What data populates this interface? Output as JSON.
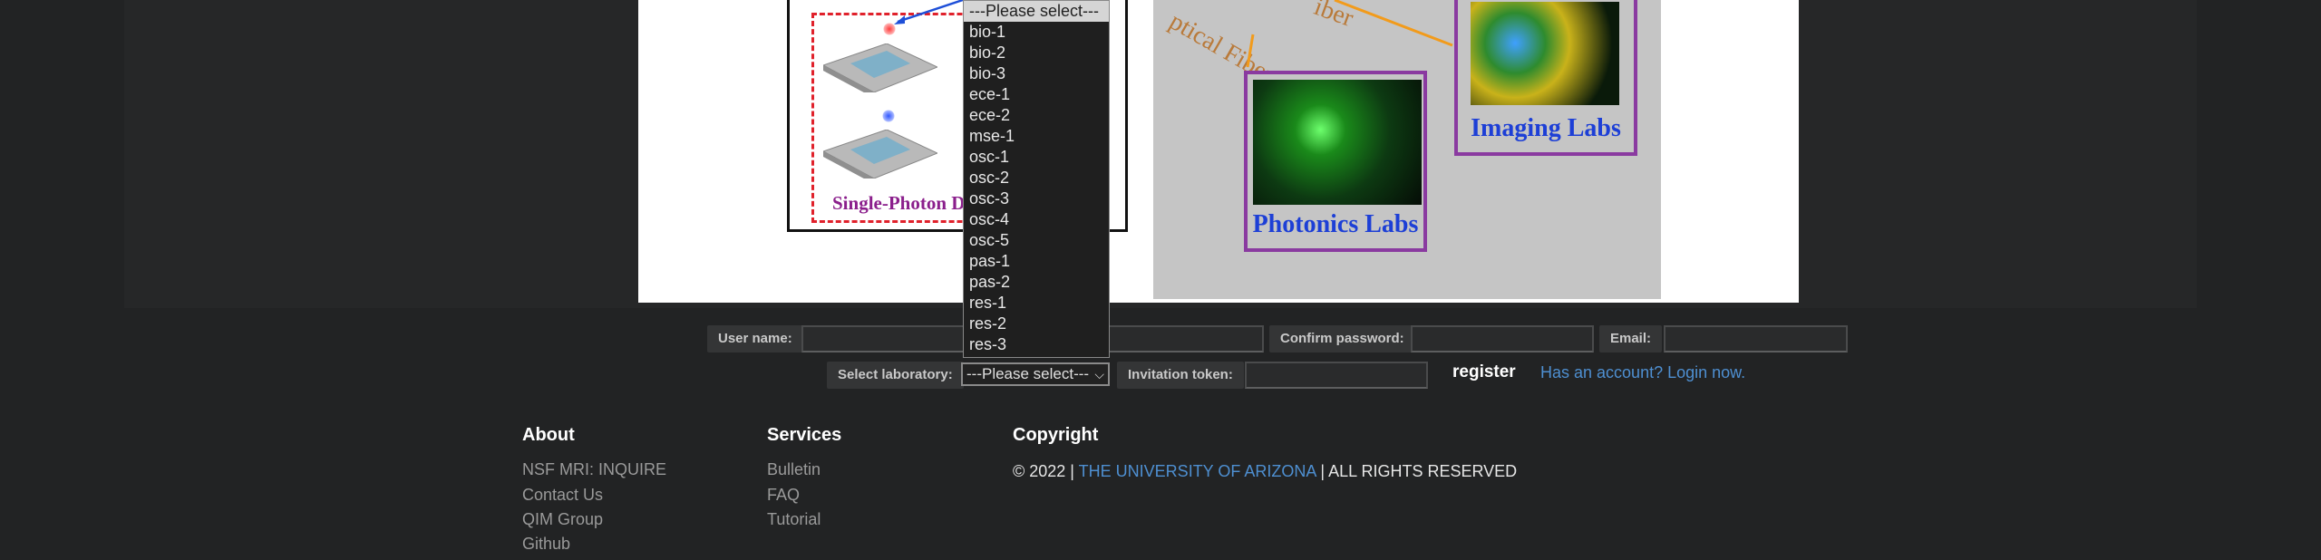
{
  "hero": {
    "photon_label": "Single-Photon D",
    "fiber_text_1": "ptical Fiber",
    "fiber_text_2": "iber",
    "photonics_caption": "Photonics Labs",
    "imaging_caption": "Imaging Labs"
  },
  "lab_dropdown": {
    "options": [
      "---Please select---",
      "bio-1",
      "bio-2",
      "bio-3",
      "ece-1",
      "ece-2",
      "mse-1",
      "osc-1",
      "osc-2",
      "osc-3",
      "osc-4",
      "osc-5",
      "pas-1",
      "pas-2",
      "res-1",
      "res-2",
      "res-3"
    ],
    "selected": "---Please select---"
  },
  "register_form": {
    "username_label": "User name:",
    "username_value": "",
    "confirm_password_label": "Confirm password:",
    "confirm_password_value": "",
    "email_label": "Email:",
    "email_value": "",
    "select_lab_label": "Select laboratory:",
    "invitation_label": "Invitation token:",
    "invitation_value": "",
    "register_label": "register",
    "login_link": "Has an account? Login now."
  },
  "footer": {
    "about": {
      "title": "About",
      "links": [
        "NSF MRI: INQUIRE",
        "Contact Us",
        "QIM Group",
        "Github"
      ]
    },
    "services": {
      "title": "Services",
      "links": [
        "Bulletin",
        "FAQ",
        "Tutorial"
      ]
    },
    "copyright": {
      "title": "Copyright",
      "prefix": "© 2022 |",
      "university": "THE UNIVERSITY OF ARIZONA",
      "suffix": "| ALL RIGHTS RESERVED"
    }
  },
  "colors": {
    "background": "#222324",
    "link": "#4e8fd1",
    "purple_frame": "#8a3aa0",
    "caption_blue": "#1d3fd6"
  }
}
